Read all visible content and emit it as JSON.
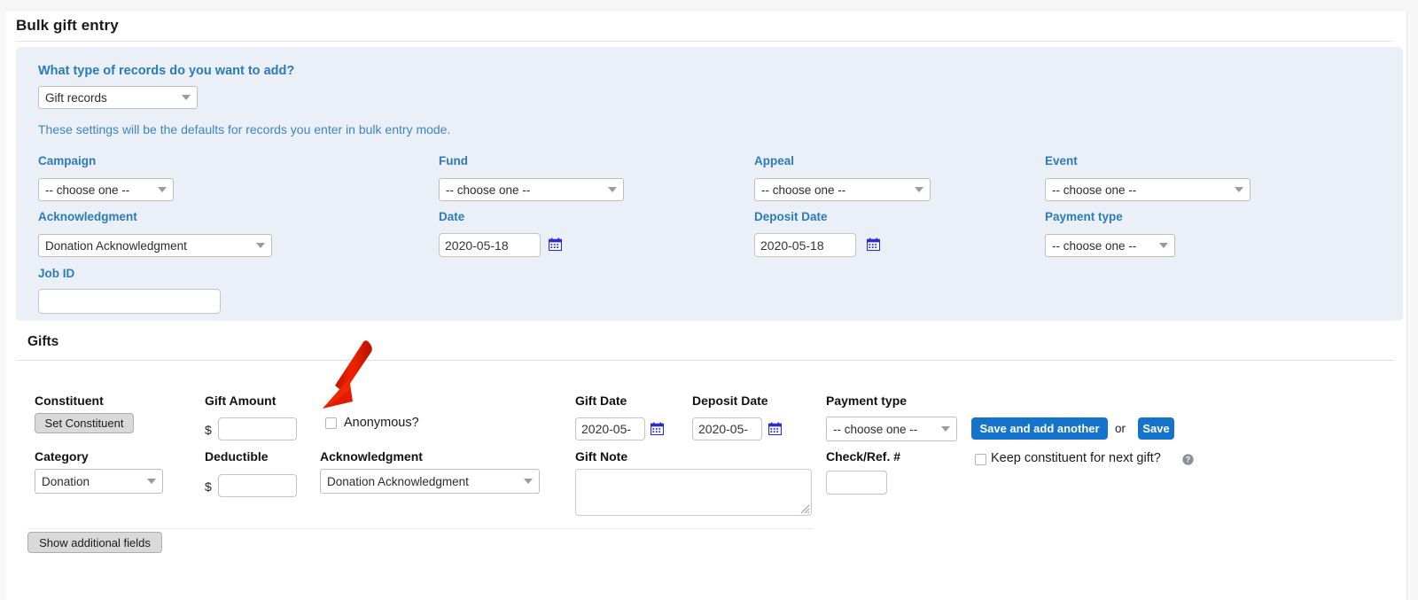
{
  "header": {
    "title": "Bulk gift entry"
  },
  "settings": {
    "question": "What type of records do you want to add?",
    "record_type_value": "Gift records",
    "note": "These settings will be the defaults for records you enter in bulk entry mode.",
    "fields": [
      {
        "label": "Campaign",
        "value": "-- choose one --",
        "type": "select"
      },
      {
        "label": "Fund",
        "value": "-- choose one --",
        "type": "select"
      },
      {
        "label": "Appeal",
        "value": "-- choose one --",
        "type": "select"
      },
      {
        "label": "Event",
        "value": "-- choose one --",
        "type": "select"
      },
      {
        "label": "Acknowledgment",
        "value": "Donation Acknowledgment",
        "type": "select"
      },
      {
        "label": "Date",
        "value": "2020-05-18",
        "type": "date"
      },
      {
        "label": "Deposit Date",
        "value": "2020-05-18",
        "type": "date"
      },
      {
        "label": "Payment type",
        "value": "-- choose one --",
        "type": "select"
      },
      {
        "label": "Job ID",
        "value": "",
        "type": "text"
      }
    ]
  },
  "gifts": {
    "section_title": "Gifts",
    "labels": {
      "constituent": "Constituent",
      "gift_amount": "Gift Amount",
      "gift_date": "Gift Date",
      "deposit_date": "Deposit Date",
      "payment_type": "Payment type",
      "category": "Category",
      "deductible": "Deductible",
      "acknowledgment": "Acknowledgment",
      "gift_note": "Gift Note",
      "check_ref": "Check/Ref. #"
    },
    "set_constituent_button": "Set Constituent",
    "currency_symbol": "$",
    "gift_amount_value": "",
    "anonymous_label": "Anonymous?",
    "anonymous_checked": false,
    "gift_date_value": "2020-05-",
    "deposit_date_value": "2020-05-",
    "payment_type_value": "-- choose one --",
    "category_value": "Donation",
    "deductible_value": "",
    "acknowledgment_value": "Donation Acknowledgment",
    "gift_note_value": "",
    "check_ref_value": "",
    "save_and_add_another_button": "Save and add another",
    "or_text": "or",
    "save_button": "Save",
    "keep_constituent_label": "Keep constituent for next gift?",
    "keep_constituent_checked": false,
    "show_additional_fields_button": "Show additional fields"
  },
  "colors": {
    "panel_background": "#ebf0f8",
    "label_blue": "#2b7bb9",
    "primary_button": "#1673cc",
    "annotation_red": "#e01b00"
  }
}
